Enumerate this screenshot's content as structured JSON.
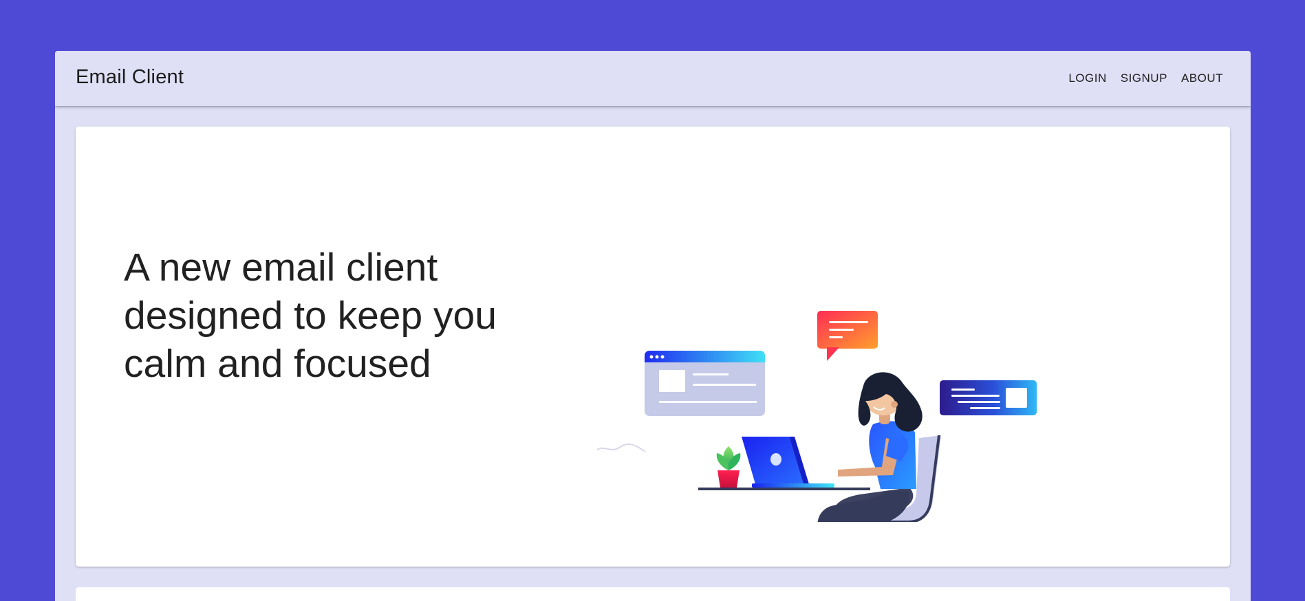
{
  "navbar": {
    "brand": "Email Client",
    "links": [
      {
        "label": "LOGIN"
      },
      {
        "label": "SIGNUP"
      },
      {
        "label": "ABOUT"
      }
    ]
  },
  "hero": {
    "headline_lines": [
      "A new email client",
      "designed to keep you",
      "calm and focused"
    ]
  },
  "colors": {
    "background": "#4f4ad6",
    "frame": "#dfdff6",
    "card": "#ffffff",
    "text": "#212121"
  }
}
